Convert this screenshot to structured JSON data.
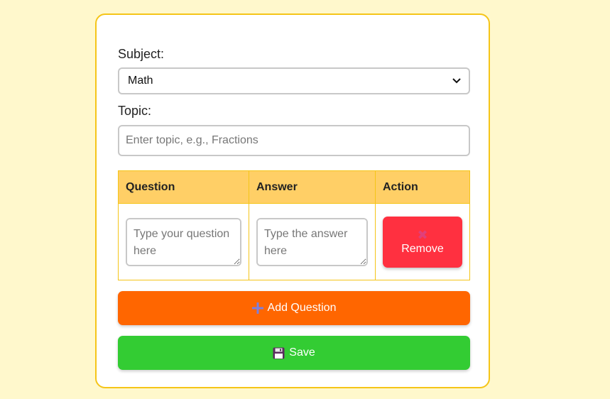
{
  "form": {
    "subject_label": "Subject:",
    "subject_value": "Math",
    "topic_label": "Topic:",
    "topic_placeholder": "Enter topic, e.g., Fractions"
  },
  "table": {
    "headers": [
      "Question",
      "Answer",
      "Action"
    ],
    "rows": [
      {
        "question_placeholder": "Type your question here",
        "answer_placeholder": "Type the answer here",
        "remove_label": "Remove",
        "remove_icon": "x-icon"
      }
    ]
  },
  "buttons": {
    "add_label": "Add Question",
    "add_icon": "plus-icon",
    "save_label": "Save",
    "save_icon": "floppy-disk-icon"
  },
  "colors": {
    "background": "#fff8cc",
    "card_border": "#f5c518",
    "header_bg": "#ffcf66",
    "remove_button": "#ff3040",
    "add_button": "#ff6600",
    "save_button": "#33cc33"
  }
}
